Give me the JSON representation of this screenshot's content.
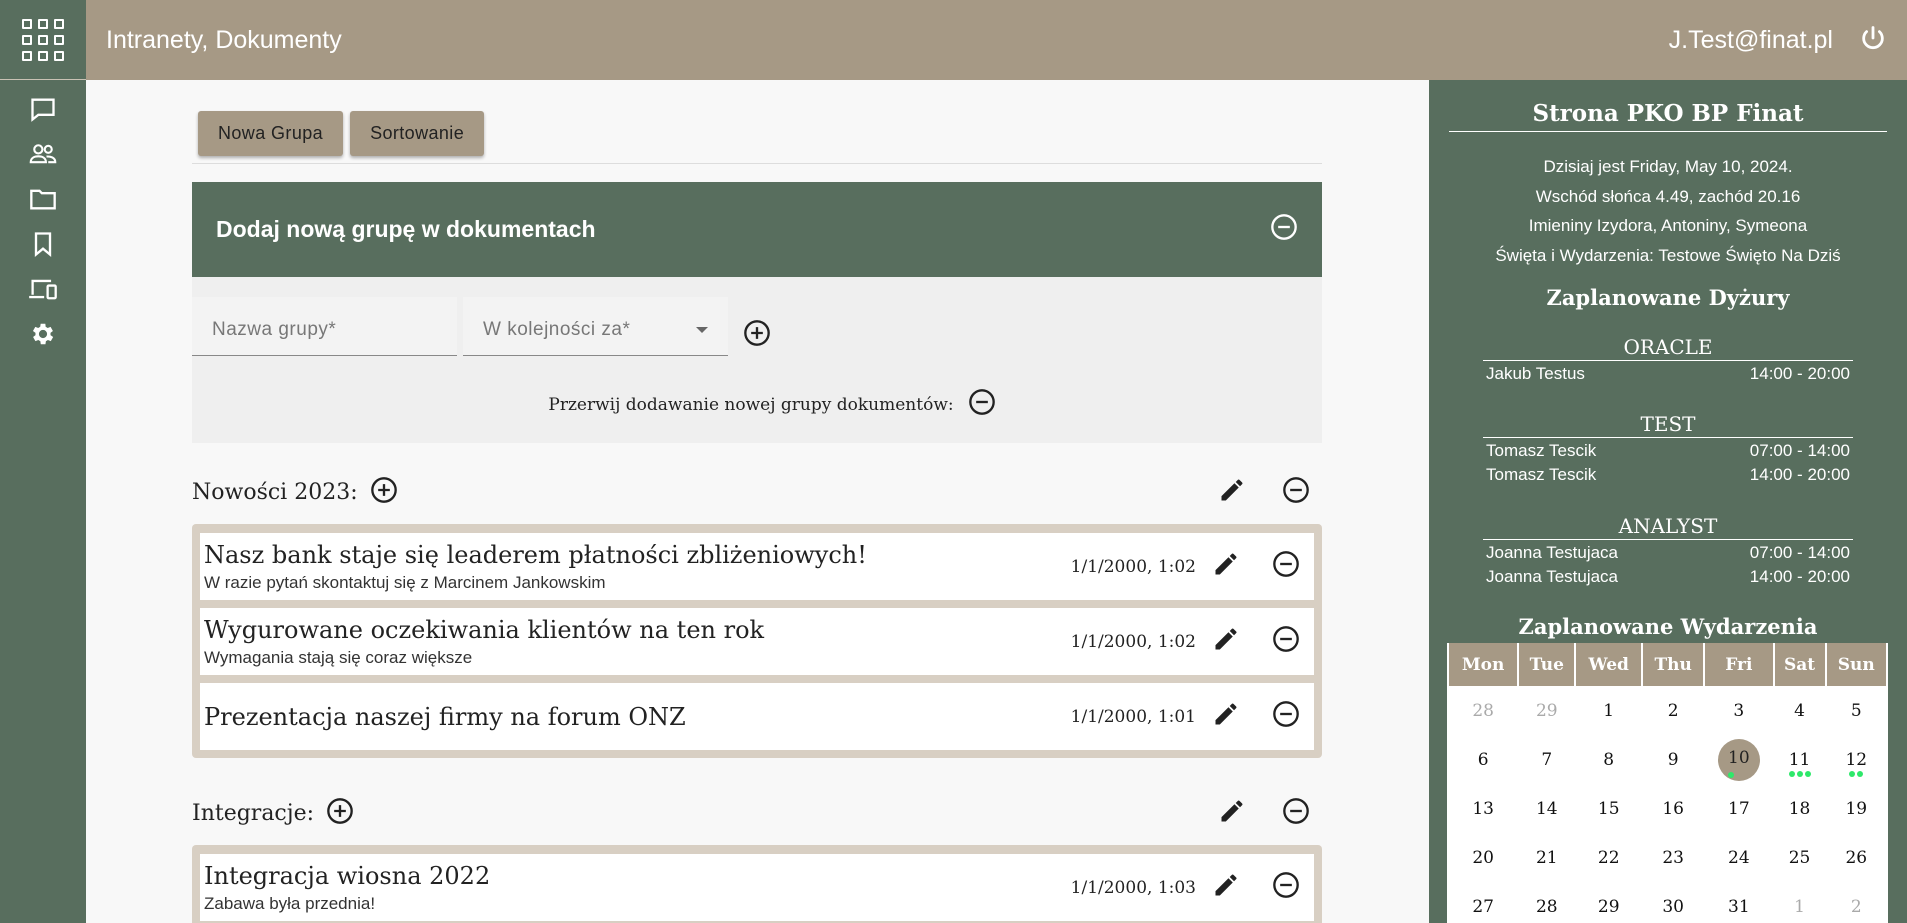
{
  "header": {
    "title": "Intranety, Dokumenty",
    "user": "J.Test@finat.pl"
  },
  "rail": {
    "icons": [
      "apps-grid-icon",
      "chat-icon",
      "people-icon",
      "folder-icon",
      "bookmark-icon",
      "devices-icon",
      "gear-icon"
    ]
  },
  "toolbar": {
    "new_group": "Nowa Grupa",
    "sort": "Sortowanie"
  },
  "add_group": {
    "title": "Dodaj nową grupę w dokumentach",
    "name_placeholder": "Nazwa grupy*",
    "order_placeholder": "W kolejności za*",
    "cancel_text": "Przerwij dodawanie nowej grupy dokumentów:"
  },
  "groups": [
    {
      "name": "Nowości 2023:",
      "docs": [
        {
          "title": "Nasz bank staje się leaderem płatności zbliżeniowych!",
          "subtitle": "W razie pytań skontaktuj się z Marcinem Jankowskim",
          "date": "1/1/2000, 1:02"
        },
        {
          "title": "Wygurowane oczekiwania klientów na ten rok",
          "subtitle": "Wymagania stają się coraz większe",
          "date": "1/1/2000, 1:02"
        },
        {
          "title": "Prezentacja naszej firmy na forum ONZ",
          "subtitle": "",
          "date": "1/1/2000, 1:01"
        }
      ]
    },
    {
      "name": "Integracje:",
      "docs": [
        {
          "title": "Integracja wiosna 2022",
          "subtitle": "Zabawa była przednia!",
          "date": "1/1/2000, 1:03"
        }
      ]
    }
  ],
  "side": {
    "title": "Strona PKO BP Finat",
    "info": [
      "Dzisiaj jest Friday, May 10, 2024.",
      "Wschód słońca 4.49, zachód 20.16",
      "Imieniny Izydora, Antoniny, Symeona",
      "Święta i Wydarzenia: Testowe Święto Na Dziś"
    ],
    "shifts_title": "Zaplanowane Dyżury",
    "shifts": [
      {
        "name": "ORACLE",
        "rows": [
          [
            "Jakub Testus",
            "14:00 - 20:00"
          ]
        ]
      },
      {
        "name": "TEST",
        "rows": [
          [
            "Tomasz Tescik",
            "07:00 - 14:00"
          ],
          [
            "Tomasz Tescik",
            "14:00 - 20:00"
          ]
        ]
      },
      {
        "name": "ANALYST",
        "rows": [
          [
            "Joanna Testujaca",
            "07:00 - 14:00"
          ],
          [
            "Joanna Testujaca",
            "14:00 - 20:00"
          ]
        ]
      }
    ],
    "events_title": "Zaplanowane Wydarzenia",
    "calendar": {
      "weekdays": [
        "Mon",
        "Tue",
        "Wed",
        "Thu",
        "Fri",
        "Sat",
        "Sun"
      ],
      "weeks": [
        [
          "28",
          "29",
          "1",
          "2",
          "3",
          "4",
          "5"
        ],
        [
          "6",
          "7",
          "8",
          "9",
          "10",
          "11",
          "12"
        ],
        [
          "13",
          "14",
          "15",
          "16",
          "17",
          "18",
          "19"
        ],
        [
          "20",
          "21",
          "22",
          "23",
          "24",
          "25",
          "26"
        ],
        [
          "27",
          "28",
          "29",
          "30",
          "31",
          "1",
          "2"
        ]
      ],
      "today": "10",
      "event_dots": {
        "10": 1,
        "11": 3,
        "12": 2
      }
    }
  },
  "colors": {
    "header": "#a69985",
    "sidebar": "#586e5e",
    "event_dot": "#2ee86a"
  }
}
